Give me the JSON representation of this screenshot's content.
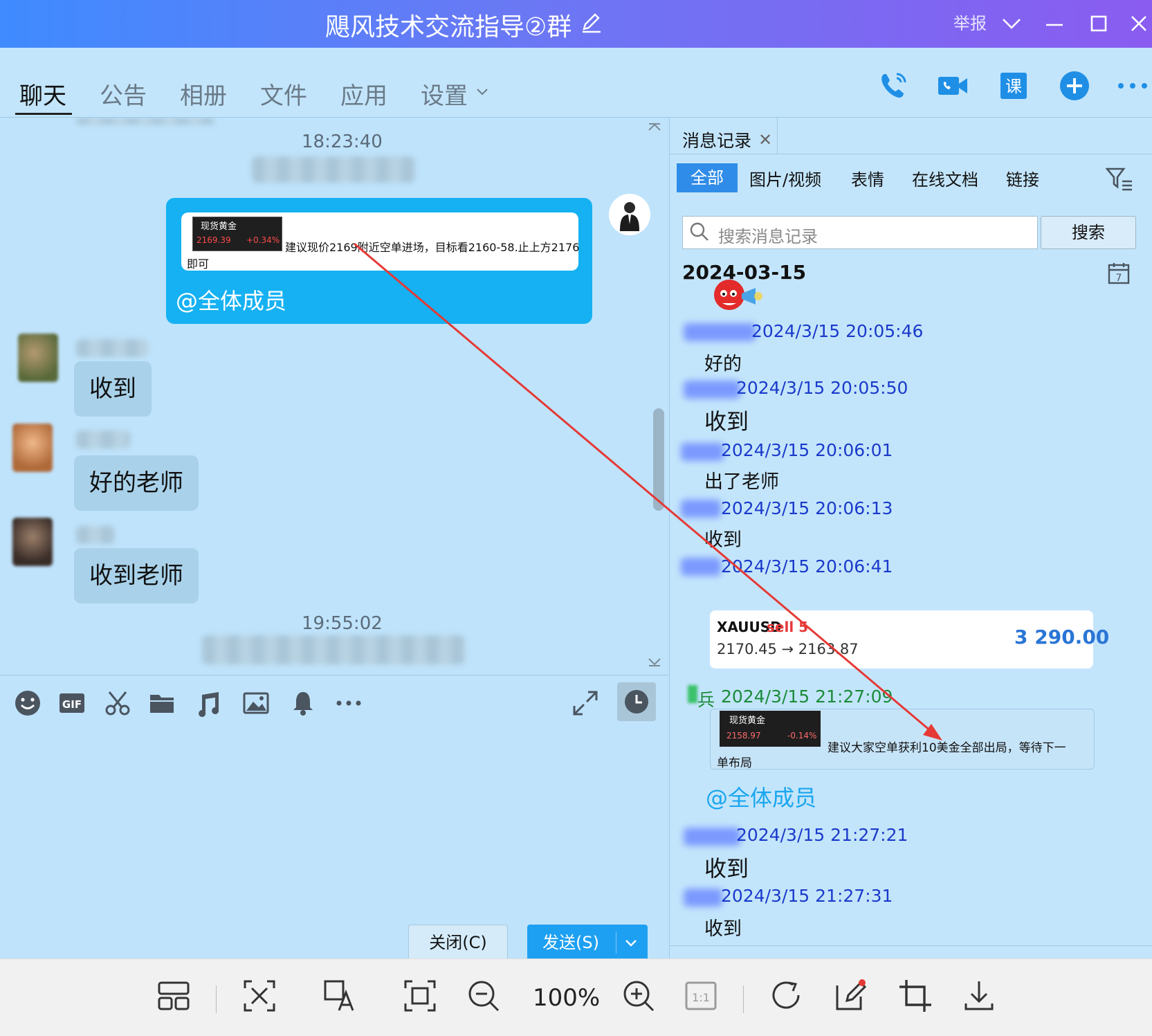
{
  "window": {
    "title": "飓风技术交流指导②群",
    "report": "举报"
  },
  "tabs": [
    {
      "label": "聊天",
      "active": true
    },
    {
      "label": "公告"
    },
    {
      "label": "相册"
    },
    {
      "label": "文件"
    },
    {
      "label": "应用"
    },
    {
      "label": "设置"
    }
  ],
  "toolbar_icons": [
    "phone-icon",
    "video-call-icon",
    "course-icon",
    "add-icon",
    "more-icon"
  ],
  "chat": {
    "time1": "18:23:40",
    "time2": "19:55:02",
    "own_message": {
      "thumb_title": "现货黄金",
      "thumb_price": "2169.39",
      "thumb_change": "+0.34%",
      "text": "建议现价2169附近空单进场，目标看2160-58.止上方2176",
      "text_cont": "即可",
      "mention": "@全体成员"
    },
    "replies": [
      {
        "text": "收到"
      },
      {
        "text": "好的老师"
      },
      {
        "text": "收到老师"
      }
    ]
  },
  "input": {
    "icons": [
      "emoji-icon",
      "gif-icon",
      "scissors-icon",
      "folder-icon",
      "music-icon",
      "image-icon",
      "bell-icon",
      "more-icon"
    ],
    "close_label": "关闭(C)",
    "send_label": "发送(S)"
  },
  "history": {
    "tab_title": "消息记录",
    "filters": [
      "全部",
      "图片/视频",
      "表情",
      "在线文档",
      "链接"
    ],
    "search_placeholder": "搜索消息记录",
    "search_button": "搜索",
    "date": "2024-03-15",
    "records": [
      {
        "time": "2024/3/15 20:05:46",
        "msg": "好的"
      },
      {
        "time": "2024/3/15 20:05:50",
        "msg": "收到"
      },
      {
        "time": "2024/3/15 20:06:01",
        "msg": "出了老师"
      },
      {
        "time": "2024/3/15 20:06:13",
        "msg": "收到"
      },
      {
        "time": "2024/3/15 20:06:41"
      },
      {
        "name_suffix": "兵",
        "time": "2024/3/15 21:27:09"
      },
      {
        "time": "2024/3/15 21:27:21",
        "msg": "收到"
      },
      {
        "time": "2024/3/15 21:27:31",
        "msg": "收到"
      }
    ],
    "trade_card": {
      "symbol": "XAUUSD",
      "side": "sell 5",
      "path": "2170.45 → 2163.87",
      "amount": "3 290.00"
    },
    "quote2": {
      "thumb_title": "现货黄金",
      "thumb_price": "2158.97",
      "thumb_change": "-0.14%",
      "text": "建议大家空单获利10美金全部出局，等待下一",
      "text_cont": "单布局",
      "mention": "@全体成员"
    }
  },
  "viewer": {
    "zoom": "100%"
  },
  "colors": {
    "title_gradient_start": "#3f8bff",
    "title_gradient_end": "#8a5cf0",
    "chat_bg": "#bfe3fb",
    "own_bubble": "#15b1f2",
    "record_time": "#1a3acb",
    "arrow": "#e53935"
  }
}
